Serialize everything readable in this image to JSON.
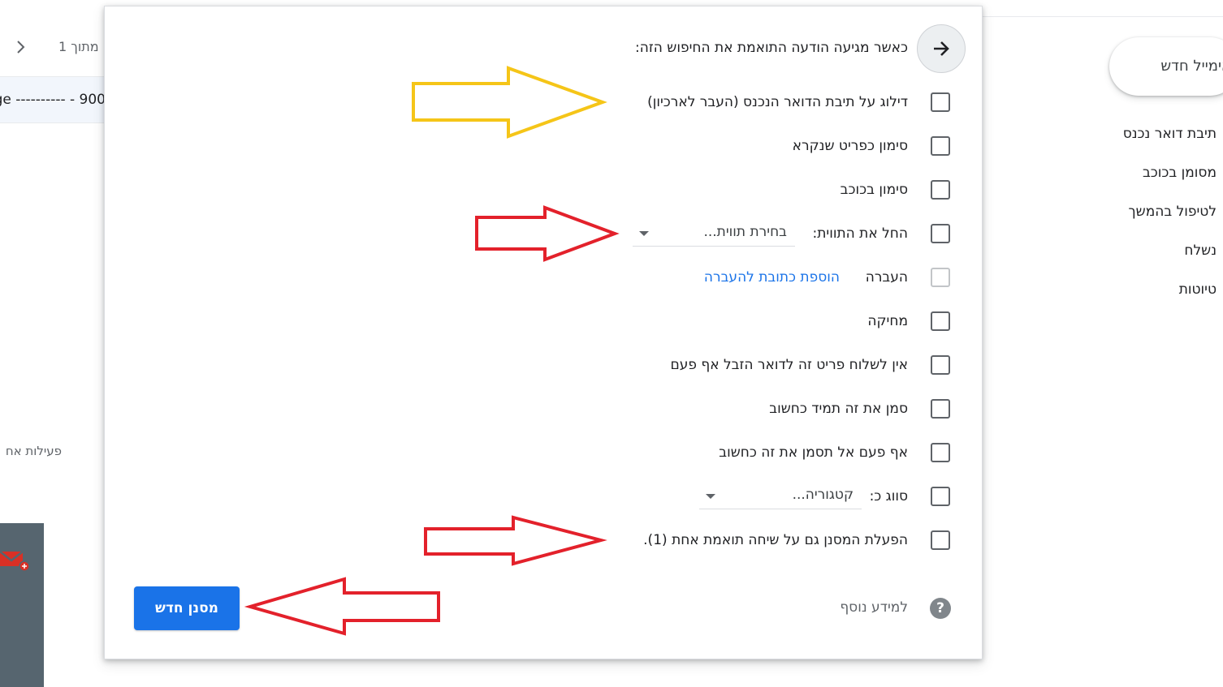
{
  "sidebar": {
    "compose_label": "אימייל חדש",
    "items": [
      {
        "label": "תיבת דואר נכנס"
      },
      {
        "label": "מסומן בכוכב"
      },
      {
        "label": "לטיפול בהמשך"
      },
      {
        "label": "נשלח"
      },
      {
        "label": "טיוטות"
      }
    ]
  },
  "mail_list": {
    "pager_text": "1 מתוך",
    "row_snippet": "ge ---------- - 900",
    "activity_text": "פעילות אח"
  },
  "filter_dialog": {
    "header": "כאשר מגיעה הודעה התואמת את החיפוש הזה:",
    "options": {
      "skip_inbox": "דילוג על תיבת הדואר הנכנס (העבר לארכיון)",
      "mark_read": "סימון כפריט שנקרא",
      "star": "סימון בכוכב",
      "apply_label": "החל את התווית:",
      "label_select": "בחירת תווית...",
      "forward": "העברה",
      "forward_link": "הוספת כתובת להעברה",
      "delete": "מחיקה",
      "never_spam": "אין לשלוח פריט זה לדואר הזבל אף פעם",
      "always_important": "סמן את זה תמיד כחשוב",
      "never_important": "אף פעם אל תסמן את זה כחשוב",
      "categorize": "סווג כ:",
      "category_select": "קטגוריה...",
      "also_apply": "הפעלת המסנן גם על שיחה תואמת אחת (1)."
    },
    "learn_more": "למידע נוסף",
    "create_button": "מסנן חדש"
  },
  "annotations": {
    "arrow_colors": {
      "highlight": "#f5c518",
      "alert": "#e3212b"
    }
  },
  "colors": {
    "primary": "#1a73e8",
    "sidebar_panel": "#56656f"
  }
}
